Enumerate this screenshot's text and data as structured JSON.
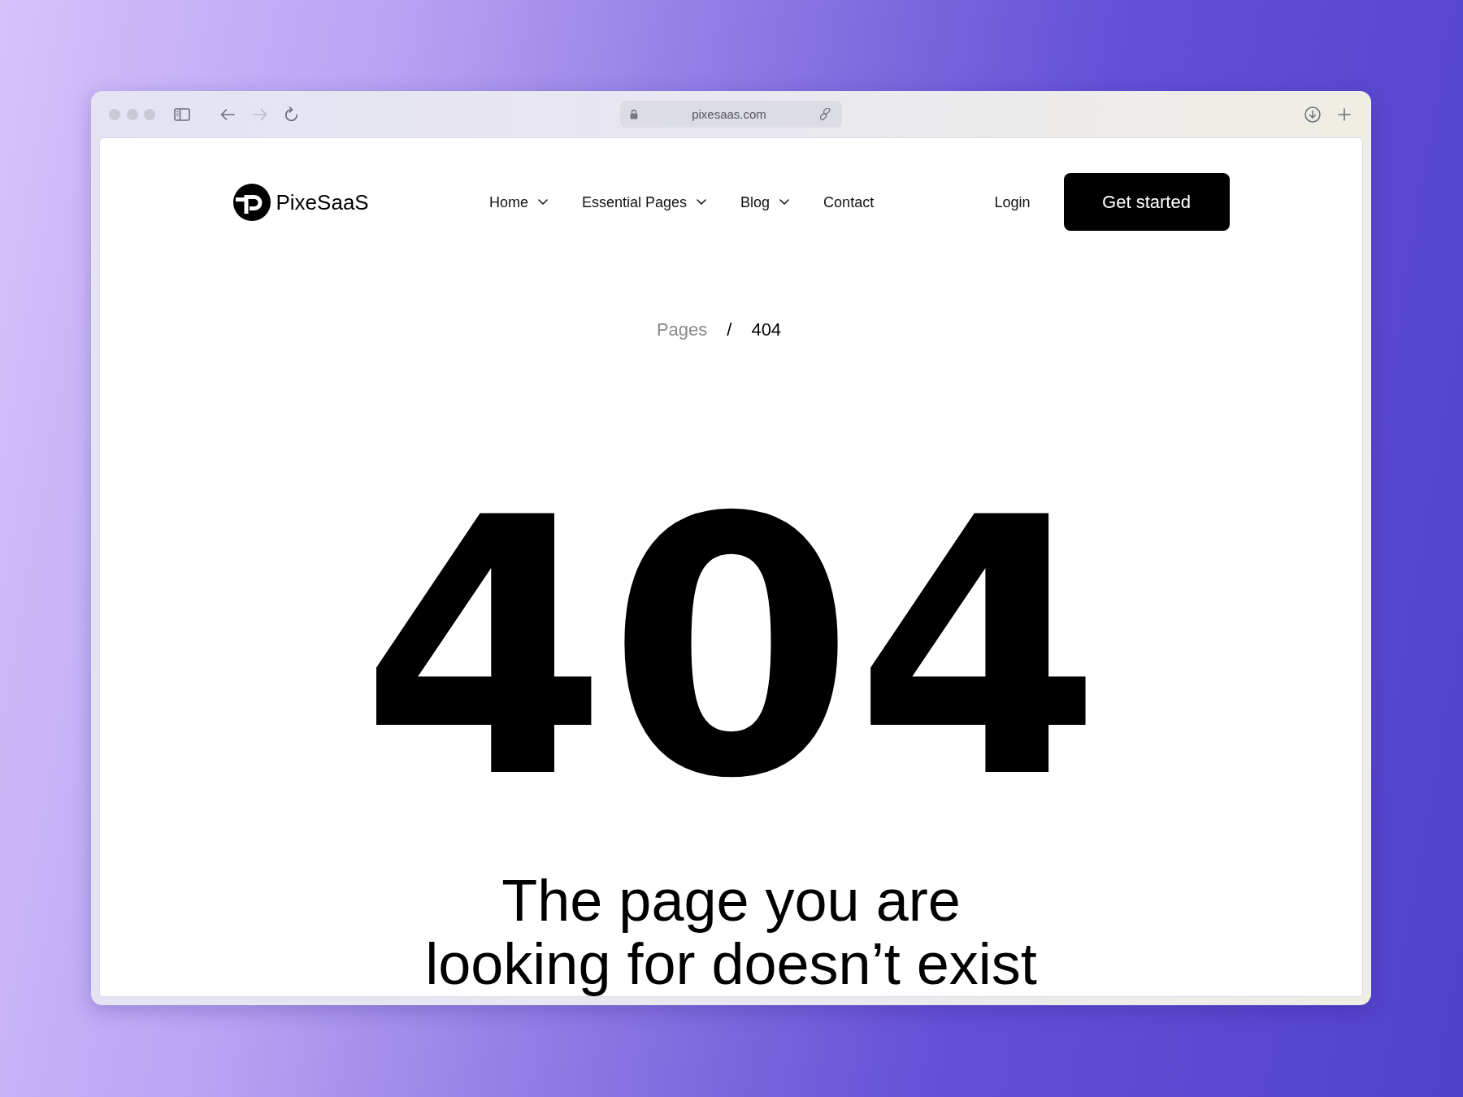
{
  "browser": {
    "buttons": [
      {
        "kind": "back",
        "disabled": false
      },
      {
        "kind": "forward",
        "disabled": true
      },
      {
        "kind": "reload",
        "disabled": false
      }
    ],
    "address_bar": {
      "url": "pixesaas.com"
    }
  },
  "header": {
    "logo": {
      "text": "PixeSaaS"
    },
    "nav": [
      {
        "label": "Home",
        "has_dropdown": true
      },
      {
        "label": "Essential Pages",
        "has_dropdown": true
      },
      {
        "label": "Blog",
        "has_dropdown": true
      },
      {
        "label": "Contact",
        "has_dropdown": false
      }
    ],
    "login": {
      "label": "Login"
    },
    "cta": {
      "label": "Get started"
    }
  },
  "breadcrumb": {
    "separator": "/",
    "items": [
      {
        "label": "Pages",
        "current": false
      },
      {
        "label": "404",
        "current": true
      }
    ]
  },
  "error_code": "404",
  "message": "The page you are looking for doesn’t exist"
}
